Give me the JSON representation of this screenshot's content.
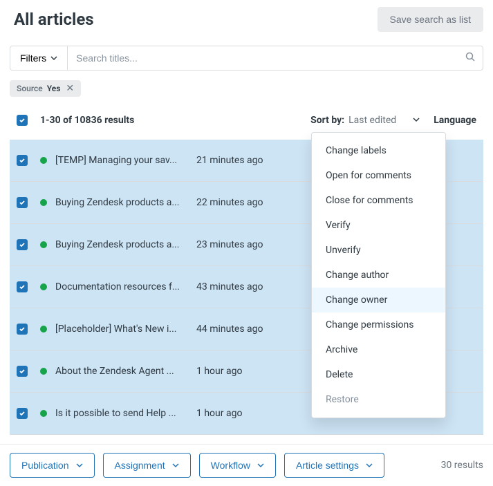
{
  "header": {
    "title": "All articles",
    "save_btn": "Save search as list"
  },
  "filters": {
    "label": "Filters"
  },
  "search": {
    "placeholder": "Search titles..."
  },
  "chip": {
    "key": "Source",
    "value": "Yes"
  },
  "summary": {
    "count_label": "1-30 of 10836 results",
    "sort_label": "Sort by:",
    "sort_value": "Last edited",
    "lang_label": "Language"
  },
  "rows": [
    {
      "title": "[TEMP] Managing your sav...",
      "time": "21 minutes ago"
    },
    {
      "title": "Buying Zendesk products a...",
      "time": "22 minutes ago"
    },
    {
      "title": "Buying Zendesk products a...",
      "time": "23 minutes ago"
    },
    {
      "title": "Documentation resources f...",
      "time": "43 minutes ago"
    },
    {
      "title": "[Placeholder] What's New i...",
      "time": "44 minutes ago"
    },
    {
      "title": "About the Zendesk Agent ...",
      "time": "1 hour ago"
    },
    {
      "title": "Is it possible to send Help ...",
      "time": "1 hour ago"
    }
  ],
  "menu": {
    "items": [
      "Change labels",
      "Open for comments",
      "Close for comments",
      "Verify",
      "Unverify",
      "Change author",
      "Change owner",
      "Change permissions",
      "Archive",
      "Delete",
      "Restore"
    ],
    "highlighted_index": 6,
    "disabled_index": 10
  },
  "footer": {
    "publication": "Publication",
    "assignment": "Assignment",
    "workflow": "Workflow",
    "article_settings": "Article settings",
    "count": "30 results"
  }
}
